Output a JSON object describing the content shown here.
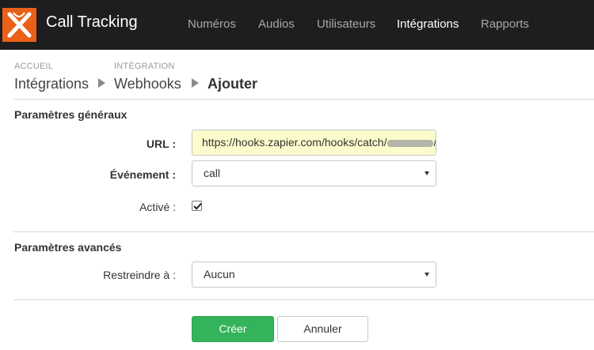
{
  "app": {
    "brand": "Call Tracking",
    "logo_icon": "x-logo-icon",
    "accent": "#e96119"
  },
  "nav": {
    "items": [
      {
        "label": "Numéros"
      },
      {
        "label": "Audios"
      },
      {
        "label": "Utilisateurs"
      },
      {
        "label": "Intégrations",
        "active": true
      },
      {
        "label": "Rapports"
      }
    ]
  },
  "breadcrumb": {
    "home_small": "ACCUEIL",
    "home_link": "Intégrations",
    "section_small": "INTÉGRATION",
    "section_link": "Webhooks",
    "current": "Ajouter"
  },
  "general": {
    "title": "Paramètres généraux",
    "url_label": "URL :",
    "url_value": "https://hooks.zapier.com/hooks/catch/",
    "event_label": "Événement :",
    "event_value": "call",
    "active_label": "Activé :",
    "active_checked": true
  },
  "advanced": {
    "title": "Paramètres avancés",
    "restrict_label": "Restreindre à :",
    "restrict_value": "Aucun"
  },
  "actions": {
    "create_label": "Créer",
    "cancel_label": "Annuler",
    "primary_color": "#33b35a"
  }
}
